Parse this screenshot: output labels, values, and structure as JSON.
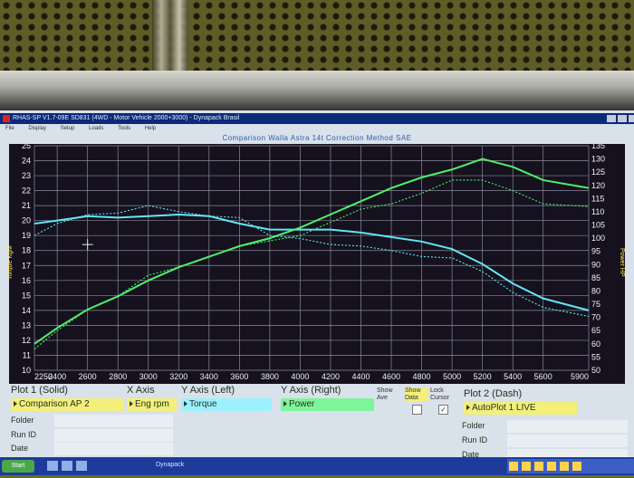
{
  "window": {
    "title": "RHAS-SP V1.7-09E SD831 (4WD - Motor Vehicle 2000+3000) - Dynapack Brasil",
    "menu": [
      "File",
      "Display",
      "Setup",
      "Loads",
      "Tools",
      "Help"
    ]
  },
  "chart_header": "Comparison Walla Astra 14t   Correction Method SAE",
  "chart_data": {
    "type": "line",
    "ylabel_left": "Torque KgM",
    "ylabel_right": "Power HP",
    "x": [
      2250,
      2400,
      2600,
      2800,
      3000,
      3200,
      3400,
      3600,
      3800,
      4000,
      4200,
      4400,
      4600,
      4800,
      5000,
      5200,
      5400,
      5600,
      5900
    ],
    "x_ticks": [
      2250,
      2400,
      2600,
      2800,
      3000,
      3200,
      3400,
      3600,
      3800,
      4000,
      4200,
      4400,
      4600,
      4800,
      5000,
      5200,
      5400,
      5600,
      5900
    ],
    "xlim": [
      2250,
      5900
    ],
    "ylim_left": [
      10,
      25
    ],
    "ylim_right": [
      50,
      135
    ],
    "y_left_ticks": [
      10,
      11,
      12,
      13,
      14,
      15,
      16,
      17,
      18,
      19,
      20,
      21,
      22,
      23,
      24,
      25
    ],
    "y_right_ticks": [
      50,
      55,
      60,
      65,
      70,
      75,
      80,
      85,
      90,
      95,
      100,
      105,
      110,
      115,
      120,
      125,
      130,
      135
    ],
    "grid": true,
    "series": [
      {
        "name": "Torque - Plot 1 (Solid)",
        "axis": "left",
        "color": "#63e6f7",
        "style": "solid",
        "values": [
          19.8,
          20.0,
          20.3,
          20.2,
          20.3,
          20.4,
          20.3,
          19.8,
          19.4,
          19.4,
          19.4,
          19.2,
          18.9,
          18.6,
          18.1,
          17.1,
          15.8,
          14.8,
          14.0
        ]
      },
      {
        "name": "Torque - Plot 2 (Dash)",
        "axis": "left",
        "color": "#63e6f7",
        "style": "dash",
        "values": [
          19.0,
          19.8,
          20.4,
          20.5,
          21.0,
          20.6,
          20.3,
          20.2,
          19.0,
          18.8,
          18.4,
          18.3,
          18.0,
          17.6,
          17.5,
          16.6,
          15.2,
          14.2,
          13.6
        ]
      },
      {
        "name": "Power - Plot 1 (Solid)",
        "axis": "right",
        "color": "#4ef06a",
        "style": "solid",
        "values": [
          60,
          66,
          73,
          78,
          84,
          89,
          93,
          97,
          100,
          104,
          109,
          114,
          119,
          123,
          126,
          130,
          127,
          122,
          119
        ]
      },
      {
        "name": "Power - Plot 2 (Dash)",
        "axis": "right",
        "color": "#4ef06a",
        "style": "dash",
        "values": [
          58,
          65,
          73,
          78,
          86,
          89,
          93,
          97,
          99,
          101,
          106,
          111,
          113,
          117,
          122,
          122,
          118,
          113,
          112
        ]
      }
    ]
  },
  "controls": {
    "plot1_header": "Plot 1 (Solid)",
    "plot1_value": "Comparison AP 2",
    "xaxis_header": "X Axis",
    "xaxis_value": "Eng rpm",
    "yleft_header": "Y Axis (Left)",
    "yleft_value": "Torque",
    "yright_header": "Y Axis (Right)",
    "yright_value": "Power",
    "show_ave": "Show Ave",
    "show_data": "Show Data",
    "lock_cursor": "Lock Cursor",
    "plot2_header": "Plot 2 (Dash)",
    "plot2_value": "AutoPlot 1 LIVE",
    "folder_label": "Folder",
    "runid_label": "Run ID",
    "date_label": "Date",
    "folder2_label": "Folder",
    "runid2_label": "Run ID",
    "date2_label": "Date"
  },
  "taskbar": {
    "start_label": "Start",
    "app_label": "Dynapack"
  },
  "colors": {
    "plot_bg": "#15111e",
    "grid": "#8c8b9a",
    "axis_text": "#f2f2f2",
    "yellow_field": "#f3ef7a",
    "cyan_field": "#9df1ff",
    "green_field": "#7ff59a"
  }
}
